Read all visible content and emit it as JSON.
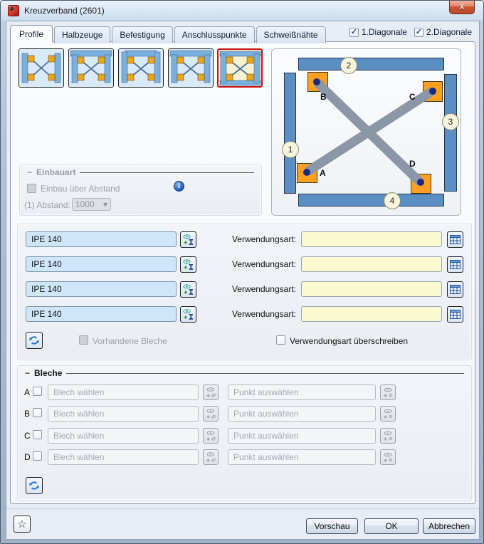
{
  "window": {
    "title": "Kreuzverband (2601)"
  },
  "icons": {
    "close": "X",
    "check": "✓",
    "dropdown_arrow": "▾",
    "star": "☆",
    "collapse": "−",
    "info": "i"
  },
  "tabs": [
    {
      "label": "Profile",
      "active": true
    },
    {
      "label": "Halbzeuge",
      "active": false
    },
    {
      "label": "Befestigung",
      "active": false
    },
    {
      "label": "Anschlusspunkte",
      "active": false
    },
    {
      "label": "Schweißnähte",
      "active": false
    }
  ],
  "diagonal_toggles": [
    {
      "label": "1.Diagonale",
      "checked": true
    },
    {
      "label": "2.Diagonale",
      "checked": true
    }
  ],
  "variant_thumbnails": {
    "count": 5,
    "selected_index": 4
  },
  "preview": {
    "markers": [
      {
        "num": "1"
      },
      {
        "num": "2"
      },
      {
        "num": "3"
      },
      {
        "num": "4"
      }
    ],
    "corners": [
      {
        "label": "A"
      },
      {
        "label": "B"
      },
      {
        "label": "C"
      },
      {
        "label": "D"
      }
    ]
  },
  "einbauart": {
    "title": "Einbauart",
    "checkbox_label": "Einbau über Abstand",
    "abstand_label": "(1) Abstand:",
    "abstand_value": "1000"
  },
  "profiles": {
    "rows": [
      {
        "profile": "IPE 140",
        "verwendungsart_label": "Verwendungsart:",
        "verwendungsart_value": ""
      },
      {
        "profile": "IPE 140",
        "verwendungsart_label": "Verwendungsart:",
        "verwendungsart_value": ""
      },
      {
        "profile": "IPE 140",
        "verwendungsart_label": "Verwendungsart:",
        "verwendungsart_value": ""
      },
      {
        "profile": "IPE 140",
        "verwendungsart_label": "Verwendungsart:",
        "verwendungsart_value": ""
      }
    ],
    "vorhandene_bleche_label": "Vorhandene Bleche",
    "verwendungsart_ueberschreiben_label": "Verwendungsart überschreiben"
  },
  "bleche": {
    "title": "Bleche",
    "rows": [
      {
        "letter": "A",
        "blech_placeholder": "Blech wählen",
        "punkt_placeholder": "Punkt auswählen"
      },
      {
        "letter": "B",
        "blech_placeholder": "Blech wählen",
        "punkt_placeholder": "Punkt auswählen"
      },
      {
        "letter": "C",
        "blech_placeholder": "Blech wählen",
        "punkt_placeholder": "Punkt auswählen"
      },
      {
        "letter": "D",
        "blech_placeholder": "Blech wählen",
        "punkt_placeholder": "Punkt auswählen"
      }
    ]
  },
  "footer": {
    "vorschau_label": "Vorschau",
    "ok_label": "OK",
    "abbrechen_label": "Abbrechen"
  },
  "colors": {
    "selected_border": "#cc1111",
    "steel_blue": "#5b8fc3",
    "plate_orange": "#ffa11e",
    "brace_gray": "#8b96a6",
    "node_navy": "#1b2a7e",
    "profile_field_bg": "#cfe5fa",
    "usage_field_bg": "#fbf9d0",
    "accent_blue": "#2f7bc9",
    "close_red": "#cb5536"
  }
}
